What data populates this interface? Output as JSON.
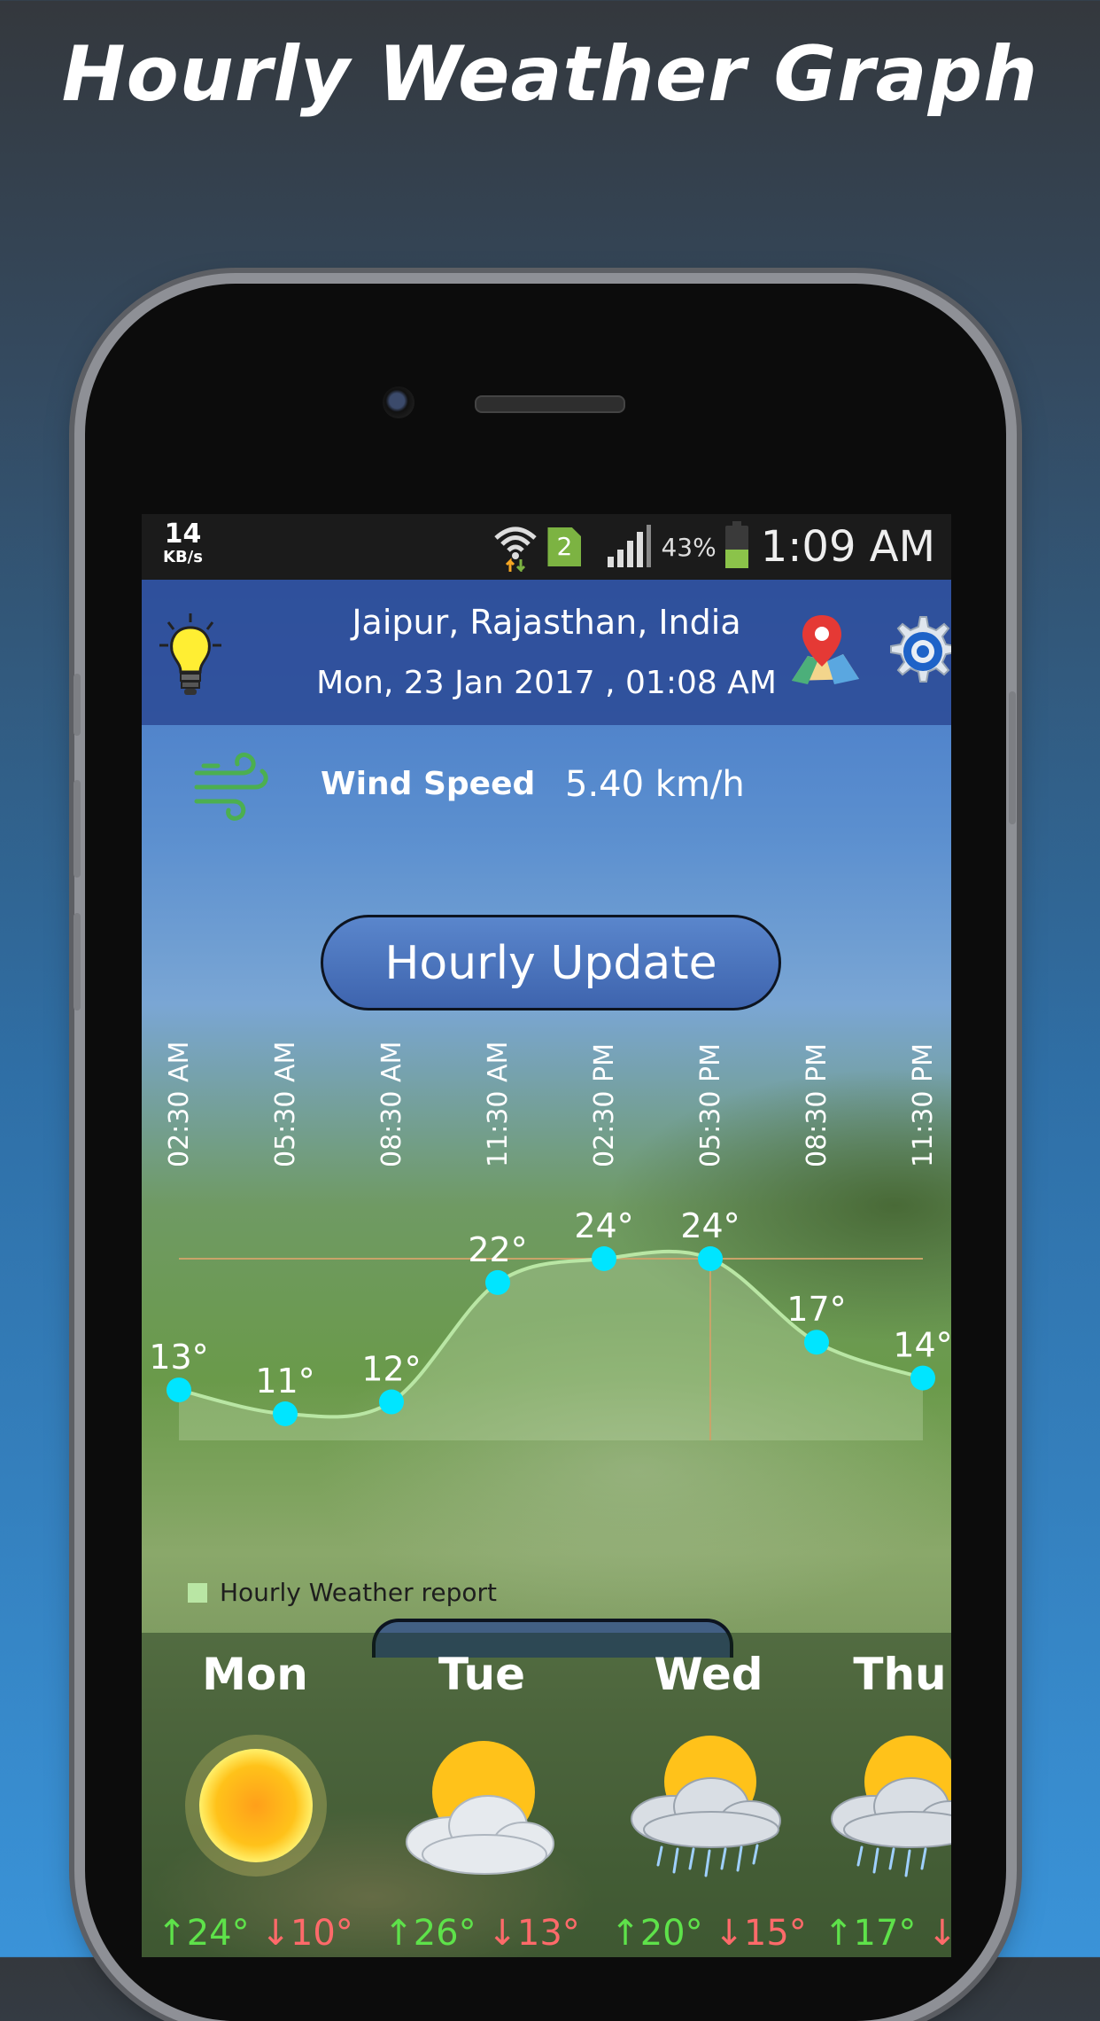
{
  "promo": {
    "title": "Hourly Weather Graph"
  },
  "status_bar": {
    "net_speed_value": "14",
    "net_speed_unit": "KB/s",
    "sim_number": "2",
    "battery_percent": "43%",
    "time": "1:09 AM",
    "battery_level": 0.43
  },
  "header": {
    "location": "Jaipur, Rajasthan, India",
    "datetime": "Mon, 23 Jan 2017 , 01:08 AM",
    "icons": [
      "lightbulb-icon",
      "map-pin-icon",
      "gear-icon"
    ]
  },
  "wind": {
    "label": "Wind Speed",
    "value": "5.40 km/h",
    "icon": "wind-icon"
  },
  "hourly_button": {
    "label": "Hourly Update"
  },
  "chart_data": {
    "type": "line",
    "title": "",
    "x": [
      "02:30 AM",
      "05:30 AM",
      "08:30 AM",
      "11:30 AM",
      "02:30 PM",
      "05:30 PM",
      "08:30 PM",
      "11:30 PM"
    ],
    "series": [
      {
        "name": "Hourly Weather report",
        "values": [
          13,
          11,
          12,
          22,
          24,
          24,
          17,
          14
        ]
      }
    ],
    "point_labels": [
      "13°",
      "11°",
      "12°",
      "22°",
      "24°",
      "24°",
      "17°",
      "14°"
    ],
    "legend": "bottom-left",
    "line_color": "#b9e6a4",
    "marker_color": "#00e5ff"
  },
  "legend": {
    "label": "Hourly Weather report"
  },
  "forecast": [
    {
      "day": "Mon",
      "icon": "sun-icon",
      "high": "↑24°",
      "low": "↓10°"
    },
    {
      "day": "Tue",
      "icon": "partly-cloudy-icon",
      "high": "↑26°",
      "low": "↓13°"
    },
    {
      "day": "Wed",
      "icon": "rain-icon",
      "high": "↑20°",
      "low": "↓15°"
    },
    {
      "day": "Thu",
      "icon": "rain-icon",
      "high": "↑17°",
      "low": "↓"
    }
  ]
}
